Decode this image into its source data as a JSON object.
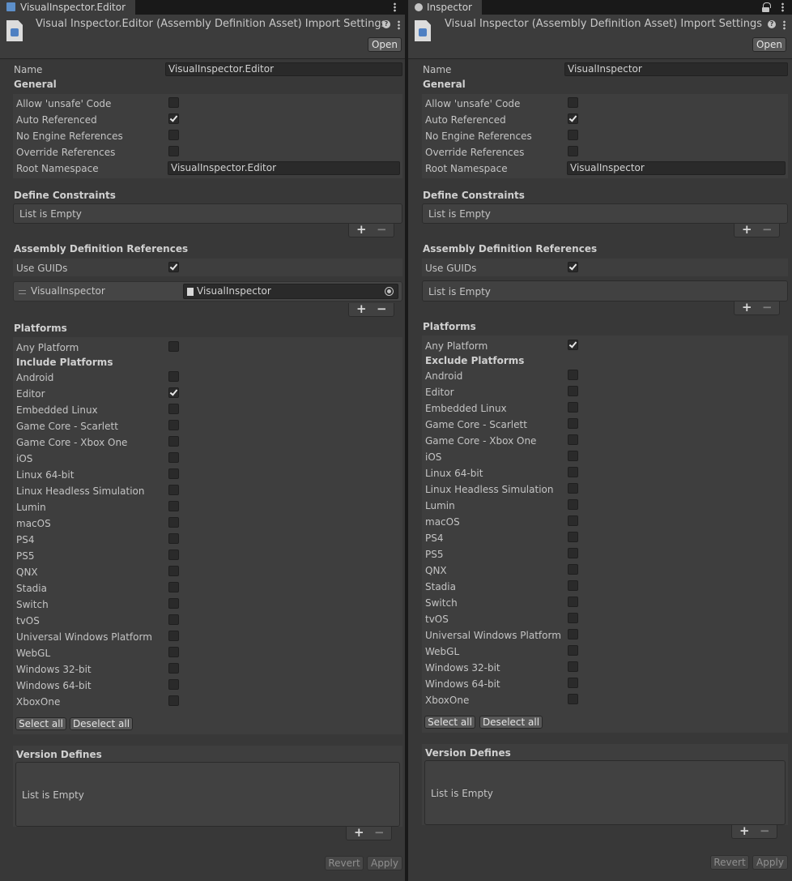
{
  "left": {
    "tab_title": "VisualInspector.Editor",
    "header_title": "Visual Inspector.Editor (Assembly Definition Asset) Import Settings",
    "open_label": "Open",
    "name_label": "Name",
    "name_value": "VisualInspector.Editor",
    "general_header": "General",
    "general": {
      "unsafe": {
        "label": "Allow 'unsafe' Code",
        "checked": false
      },
      "auto_ref": {
        "label": "Auto Referenced",
        "checked": true
      },
      "no_engine": {
        "label": "No Engine References",
        "checked": false
      },
      "override": {
        "label": "Override References",
        "checked": false
      }
    },
    "root_ns_label": "Root Namespace",
    "root_ns_value": "VisualInspector.Editor",
    "define_header": "Define Constraints",
    "define_empty": "List is Empty",
    "adr_header": "Assembly Definition References",
    "use_guids_label": "Use GUIDs",
    "use_guids_checked": true,
    "ref_item_label": "VisualInspector",
    "ref_item_value": "VisualInspector",
    "platforms_header": "Platforms",
    "any_platform_label": "Any Platform",
    "any_platform_checked": false,
    "platform_list_header": "Include Platforms",
    "platforms": [
      {
        "label": "Android",
        "checked": false
      },
      {
        "label": "Editor",
        "checked": true
      },
      {
        "label": "Embedded Linux",
        "checked": false
      },
      {
        "label": "Game Core - Scarlett",
        "checked": false
      },
      {
        "label": "Game Core - Xbox One",
        "checked": false
      },
      {
        "label": "iOS",
        "checked": false
      },
      {
        "label": "Linux 64-bit",
        "checked": false
      },
      {
        "label": "Linux Headless Simulation",
        "checked": false
      },
      {
        "label": "Lumin",
        "checked": false
      },
      {
        "label": "macOS",
        "checked": false
      },
      {
        "label": "PS4",
        "checked": false
      },
      {
        "label": "PS5",
        "checked": false
      },
      {
        "label": "QNX",
        "checked": false
      },
      {
        "label": "Stadia",
        "checked": false
      },
      {
        "label": "Switch",
        "checked": false
      },
      {
        "label": "tvOS",
        "checked": false
      },
      {
        "label": "Universal Windows Platform",
        "checked": false
      },
      {
        "label": "WebGL",
        "checked": false
      },
      {
        "label": "Windows 32-bit",
        "checked": false
      },
      {
        "label": "Windows 64-bit",
        "checked": false
      },
      {
        "label": "XboxOne",
        "checked": false
      }
    ],
    "select_all": "Select all",
    "deselect_all": "Deselect all",
    "version_header": "Version Defines",
    "version_empty": "List is Empty",
    "revert": "Revert",
    "apply": "Apply"
  },
  "right": {
    "tab_title": "Inspector",
    "header_title": "Visual Inspector (Assembly Definition Asset) Import Settings",
    "open_label": "Open",
    "name_label": "Name",
    "name_value": "VisualInspector",
    "general_header": "General",
    "general": {
      "unsafe": {
        "label": "Allow 'unsafe' Code",
        "checked": false
      },
      "auto_ref": {
        "label": "Auto Referenced",
        "checked": true
      },
      "no_engine": {
        "label": "No Engine References",
        "checked": false
      },
      "override": {
        "label": "Override References",
        "checked": false
      }
    },
    "root_ns_label": "Root Namespace",
    "root_ns_value": "VisualInspector",
    "define_header": "Define Constraints",
    "define_empty": "List is Empty",
    "adr_header": "Assembly Definition References",
    "use_guids_label": "Use GUIDs",
    "use_guids_checked": true,
    "ref_empty": "List is Empty",
    "platforms_header": "Platforms",
    "any_platform_label": "Any Platform",
    "any_platform_checked": true,
    "platform_list_header": "Exclude Platforms",
    "platforms": [
      {
        "label": "Android",
        "checked": false
      },
      {
        "label": "Editor",
        "checked": false
      },
      {
        "label": "Embedded Linux",
        "checked": false
      },
      {
        "label": "Game Core - Scarlett",
        "checked": false
      },
      {
        "label": "Game Core - Xbox One",
        "checked": false
      },
      {
        "label": "iOS",
        "checked": false
      },
      {
        "label": "Linux 64-bit",
        "checked": false
      },
      {
        "label": "Linux Headless Simulation",
        "checked": false
      },
      {
        "label": "Lumin",
        "checked": false
      },
      {
        "label": "macOS",
        "checked": false
      },
      {
        "label": "PS4",
        "checked": false
      },
      {
        "label": "PS5",
        "checked": false
      },
      {
        "label": "QNX",
        "checked": false
      },
      {
        "label": "Stadia",
        "checked": false
      },
      {
        "label": "Switch",
        "checked": false
      },
      {
        "label": "tvOS",
        "checked": false
      },
      {
        "label": "Universal Windows Platform",
        "checked": false
      },
      {
        "label": "WebGL",
        "checked": false
      },
      {
        "label": "Windows 32-bit",
        "checked": false
      },
      {
        "label": "Windows 64-bit",
        "checked": false
      },
      {
        "label": "XboxOne",
        "checked": false
      }
    ],
    "select_all": "Select all",
    "deselect_all": "Deselect all",
    "version_header": "Version Defines",
    "version_empty": "List is Empty",
    "revert": "Revert",
    "apply": "Apply"
  },
  "icons": {
    "tab_asset": "asset-icon",
    "tab_info": "info-icon",
    "lock": "lock-icon",
    "help": "help-icon",
    "menu": "kebab-menu-icon",
    "add": "plus-icon",
    "remove": "minus-icon",
    "object_picker": "object-picker-icon",
    "drag": "drag-handle-icon"
  }
}
